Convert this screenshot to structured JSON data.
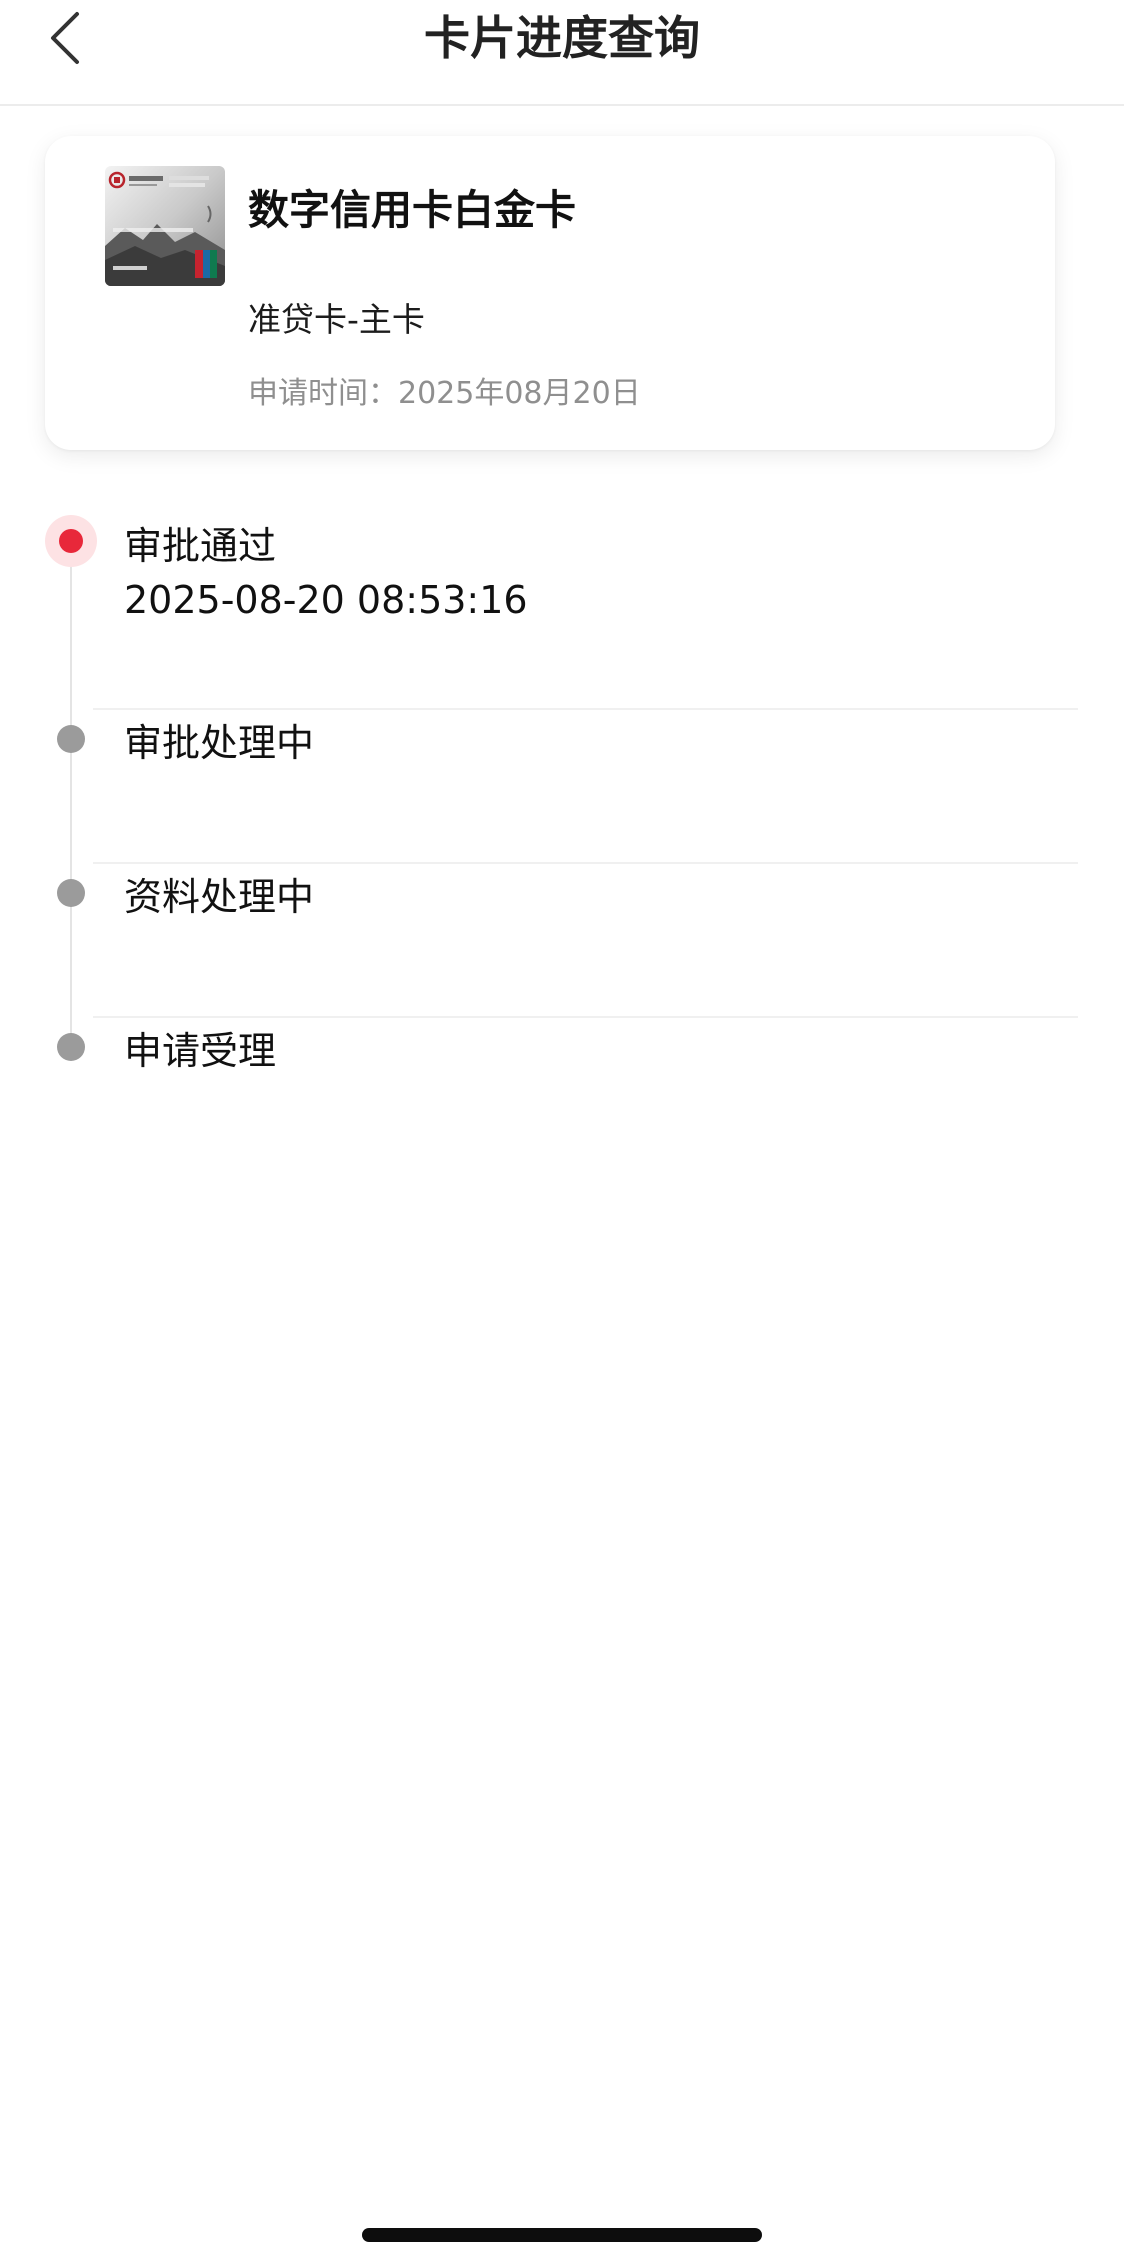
{
  "header": {
    "title": "卡片进度查询"
  },
  "card": {
    "name": "数字信用卡白金卡",
    "type": "准贷卡-主卡",
    "apply_time_label": "申请时间：",
    "apply_time_value": "2025年08月20日"
  },
  "timeline": [
    {
      "title": "审批通过",
      "time": "2025-08-20 08:53:16",
      "status": "active"
    },
    {
      "title": "审批处理中",
      "time": "",
      "status": "pending"
    },
    {
      "title": "资料处理中",
      "time": "",
      "status": "pending"
    },
    {
      "title": "申请受理",
      "time": "",
      "status": "pending"
    }
  ],
  "colors": {
    "active": "#e8283a",
    "inactive": "#9b9b9b"
  },
  "icons": {
    "back": "chevron-left-icon",
    "card": "credit-card-image"
  }
}
